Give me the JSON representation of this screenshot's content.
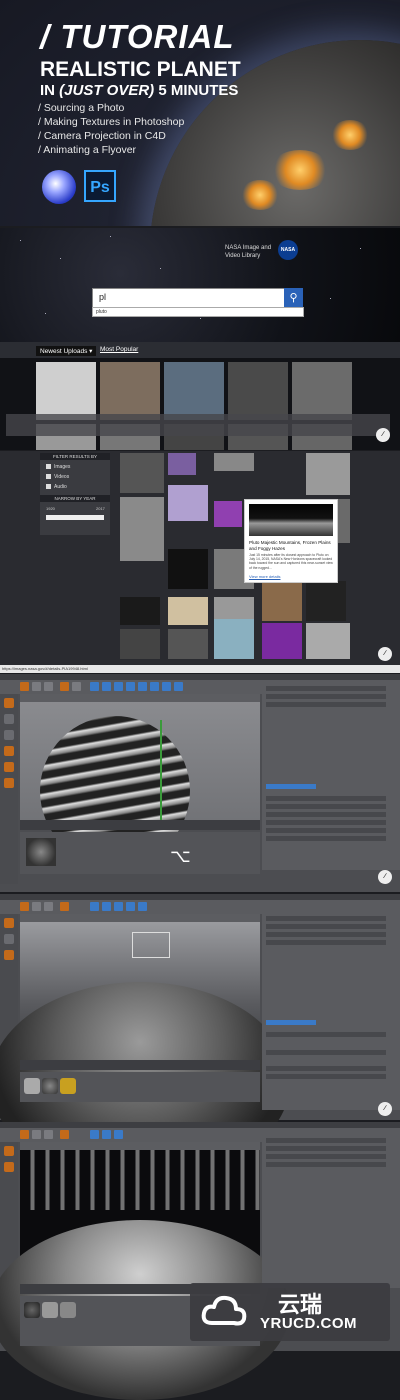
{
  "title_panel": {
    "title": "/ TUTORIAL",
    "subtitle": "REALISTIC PLANET",
    "line3_prefix": "IN ",
    "line3_italic": "(JUST OVER)",
    "line3_suffix": " 5 MINUTES",
    "bullets": [
      "/ Sourcing a Photo",
      "/ Making Textures in Photoshop",
      "/ Camera Projection in C4D",
      "/ Animating a Flyover"
    ],
    "ps_label": "Ps"
  },
  "nasa_panel": {
    "site_name_line1": "NASA Image and",
    "site_name_line2": "Video Library",
    "logo_text": "NASA",
    "search_value": "pl",
    "search_suggestion": "pluto",
    "tab_newest": "Newest Uploads",
    "tab_popular": "Most Popular"
  },
  "results_panel": {
    "filter_header": "FILTER RESULTS BY",
    "filters": [
      "Images",
      "Videos",
      "Audio"
    ],
    "year_header": "NARROW BY YEAR",
    "year_from": "1920",
    "year_to": "2017",
    "tooltip_title": "Pluto Majestic Mountains, Frozen Plains and Foggy Hazes",
    "tooltip_body": "Just 15 minutes after its closest approach to Pluto on July 14, 2015, NASA's New Horizons spacecraft looked back toward the sun and captured this near-sunset view of the rugged...",
    "tooltip_link": "View more details",
    "status_url": "https://images.nasa.gov/#/details-PIA19948.html"
  },
  "colors": {
    "c4d_bg": "#4c4d51",
    "nasa_blue": "#0b3d91",
    "accent_blue": "#2a62b8",
    "ps_blue": "#35a6ff"
  },
  "watermark": {
    "text_cn": "云瑞",
    "text_en": "YRUCD.COM"
  }
}
